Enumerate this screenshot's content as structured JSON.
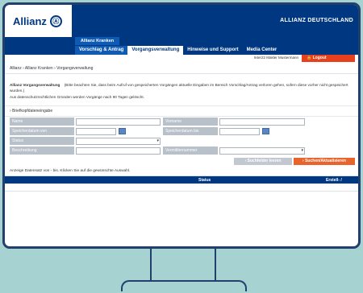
{
  "header": {
    "logo_text": "Allianz",
    "logo_mark": "Ⓐ",
    "brand": "ALLIANZ DEUTSCHLAND"
  },
  "nav": {
    "product_tab": "Allianz Kranken",
    "items": [
      {
        "label": "Vorschlag & Antrag"
      },
      {
        "label": "Vorgangsverwaltung"
      },
      {
        "label": "Hinweise und Support"
      },
      {
        "label": "Media Center"
      }
    ]
  },
  "user": {
    "name": "94er22 Makler Mustermann",
    "logout": "Logout",
    "logout_icon": "lock-icon"
  },
  "breadcrumb": {
    "items": [
      "Allianz",
      "Allianz Kranken",
      "Vorgangsverwaltung"
    ],
    "separator": "›"
  },
  "intro": {
    "title": "Allianz Vorgangsverwaltung",
    "text": "(Bitte beachten Sie, dass beim Aufruf von gespeicherten Vorgängen aktuelle Eingaben im Bereich Vorschlag/Antrag verloren gehen, sofern diese vorher nicht gespeichert wurden.)",
    "note": "Aus datenschutzrechtlichen Gründen werden Vorgänge nach 90 Tagen gelöscht."
  },
  "section": {
    "marker": "›",
    "label": "Briefkopfdateneingabe"
  },
  "form": {
    "name_label": "Name",
    "name_value": "",
    "vorname_label": "Vorname",
    "vorname_value": "",
    "speicherdatum_von_label": "Speicherdatum von",
    "speicherdatum_von_value": "",
    "speicherdatum_bis_label": "Speicherdatum bis",
    "speicherdatum_bis_value": "",
    "status_label": "Status",
    "status_value": "",
    "beschreibung_label": "Beschreibung",
    "beschreibung_value": "",
    "vermittlernummer_label": "Vermittlernummer",
    "vermittlernummer_value": "",
    "calendar_icon": "calendar-icon",
    "dropdown_icon": "chevron-down-icon",
    "dropdown_glyph": "▾"
  },
  "actions": {
    "clear_label": "› Suchfelder leeren",
    "search_label": "› Suchen/Aktualisieren"
  },
  "results": {
    "hint": "Anzeige Datensatz von - bis. Klicken Sie auf die gewünschte Auswahl.",
    "columns": [
      "Status",
      "Erstell- /"
    ]
  },
  "colors": {
    "brand_blue": "#003781",
    "accent_orange": "#e8642c",
    "logout_red": "#e8401c",
    "backdrop": "#a6d2d2"
  }
}
